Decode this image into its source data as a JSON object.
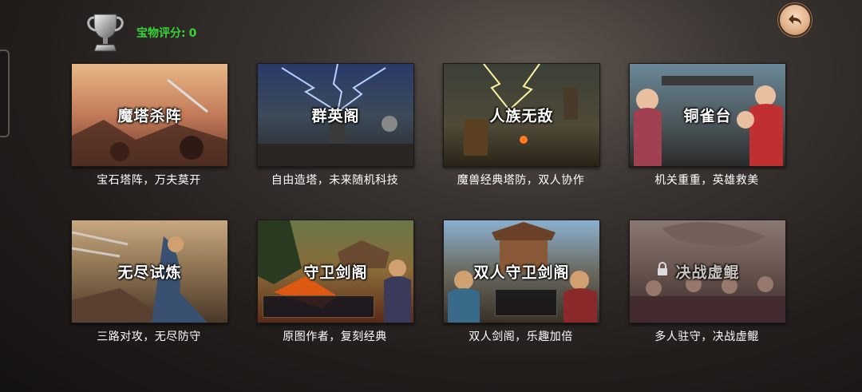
{
  "header": {
    "score_label": "宝物评分:",
    "score_value": "0",
    "back_icon": "back-arrow-icon",
    "trophy_icon": "silver-trophy-icon"
  },
  "modes": [
    {
      "title": "魔塔杀阵",
      "desc": "宝石塔阵，万夫莫开",
      "locked": false
    },
    {
      "title": "群英阁",
      "desc": "自由造塔，未来随机科技",
      "locked": false
    },
    {
      "title": "人族无敌",
      "desc": "魔兽经典塔防，双人协作",
      "locked": false
    },
    {
      "title": "铜雀台",
      "desc": "机关重重，英雄救美",
      "locked": false
    },
    {
      "title": "无尽试炼",
      "desc": "三路对攻，无尽防守",
      "locked": false
    },
    {
      "title": "守卫剑阁",
      "desc": "原图作者，复刻经典",
      "locked": false
    },
    {
      "title": "双人守卫剑阁",
      "desc": "双人剑阁，乐趣加倍",
      "locked": false
    },
    {
      "title": "决战虚鲲",
      "desc": "多人驻守，决战虚鲲",
      "locked": true
    }
  ],
  "colors": {
    "score_green": "#37d437",
    "back_button": "#e3b48d"
  }
}
